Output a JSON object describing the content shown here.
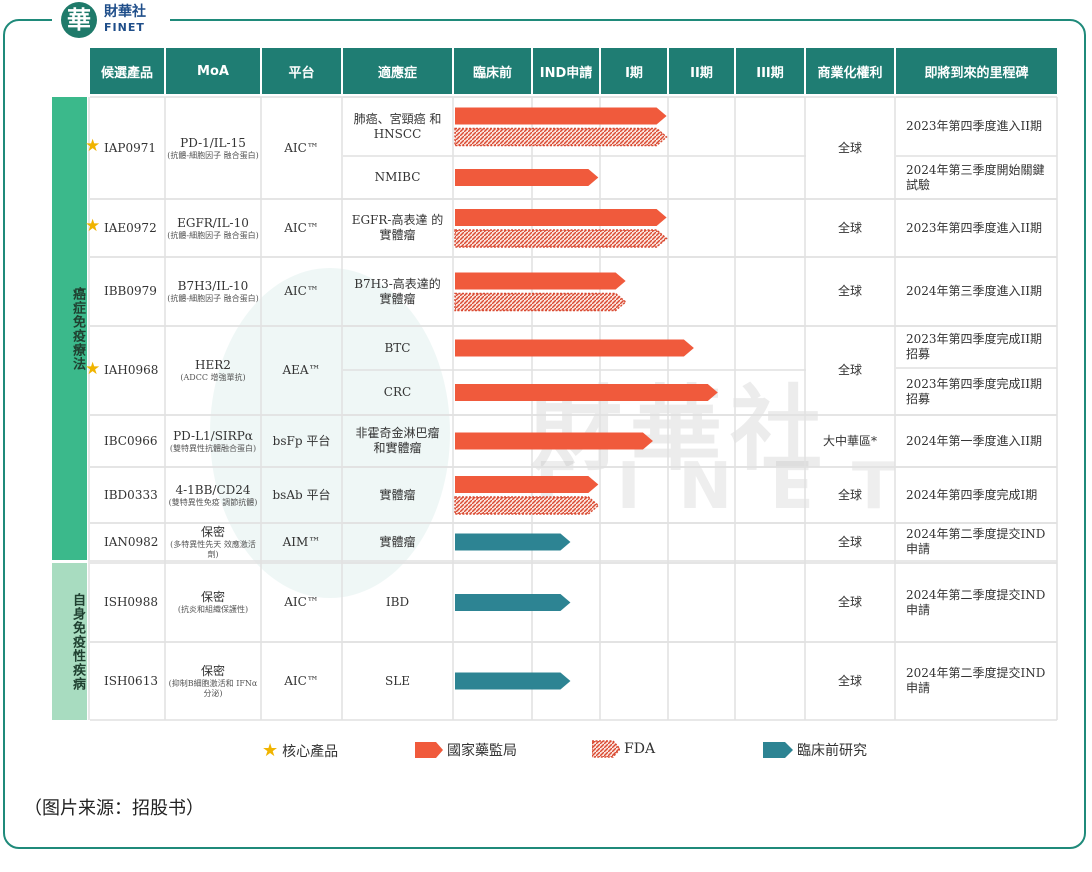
{
  "brand": {
    "mark": "華",
    "name": "財華社",
    "sub": "FINET"
  },
  "watermark": {
    "text": "財華社",
    "sub": "FINET"
  },
  "headers": [
    "候選產品",
    "MoA",
    "平台",
    "適應症",
    "臨床前",
    "IND申請",
    "I期",
    "II期",
    "III期",
    "商業化權利",
    "即將到來的里程碑"
  ],
  "categories": [
    {
      "label": "癌症免疫療法",
      "color": "#3bb98b"
    },
    {
      "label": "自身免疫性疾病",
      "color": "#a8dcc0"
    }
  ],
  "rows": [
    {
      "product": "IAP0971",
      "core": true,
      "moa": "PD-1/IL-15",
      "moa_sub": "(抗體-細胞因子 融合蛋白)",
      "platform": "AIC™",
      "indications": [
        {
          "name": "肺癌、宮頸癌 和HNSCC",
          "nmpa": 0.88,
          "fda": 0.88
        },
        {
          "name": "NMIBC",
          "nmpa": 0.6
        }
      ],
      "rights": "全球",
      "milestones": [
        "2023年第四季度進入II期",
        "2024年第三季度開始關鍵 試驗"
      ]
    },
    {
      "product": "IAE0972",
      "core": true,
      "moa": "EGFR/IL-10",
      "moa_sub": "(抗體-細胞因子 融合蛋白)",
      "platform": "AIC™",
      "indications": [
        {
          "name": "EGFR-高表達 的實體瘤",
          "nmpa": 0.88,
          "fda": 0.88
        }
      ],
      "rights": "全球",
      "milestones": [
        "2023年第四季度進入II期"
      ]
    },
    {
      "product": "IBB0979",
      "core": false,
      "moa": "B7H3/IL-10",
      "moa_sub": "(抗體-細胞因子 融合蛋白)",
      "platform": "AIC™",
      "indications": [
        {
          "name": "B7H3-高表達的 實體瘤",
          "nmpa": 0.72,
          "fda": 0.72
        }
      ],
      "rights": "全球",
      "milestones": [
        "2024年第三季度進入II期"
      ]
    },
    {
      "product": "IAH0968",
      "core": true,
      "moa": "HER2",
      "moa_sub": "(ADCC 增強單抗)",
      "platform": "AEA™",
      "indications": [
        {
          "name": "BTC",
          "nmpa": 1.0
        },
        {
          "name": "CRC",
          "nmpa": 1.1
        }
      ],
      "rights": "全球",
      "milestones": [
        "2023年第四季度完成II期 招募",
        "2023年第四季度完成II期 招募"
      ]
    },
    {
      "product": "IBC0966",
      "core": false,
      "moa": "PD-L1/SIRPα",
      "moa_sub": "(雙特異性抗體融合蛋白)",
      "platform": "bsFp 平台",
      "indications": [
        {
          "name": "非霍奇金淋巴瘤 和實體瘤",
          "nmpa": 0.8
        }
      ],
      "rights": "大中華區*",
      "milestones": [
        "2024年第一季度進入II期"
      ]
    },
    {
      "product": "IBD0333",
      "core": false,
      "moa": "4-1BB/CD24",
      "moa_sub": "(雙特異性免疫 調節抗體)",
      "platform": "bsAb 平台",
      "indications": [
        {
          "name": "實體瘤",
          "nmpa": 0.6,
          "fda": 0.6
        }
      ],
      "rights": "全球",
      "milestones": [
        "2024年第四季度完成I期"
      ]
    },
    {
      "product": "IAN0982",
      "core": false,
      "moa": "保密",
      "moa_sub": "(多特異性先天 效應激活劑)",
      "platform": "AIM™",
      "indications": [
        {
          "name": "實體瘤",
          "pre": 0.53
        }
      ],
      "rights": "全球",
      "milestones": [
        "2024年第二季度提交IND 申請"
      ]
    },
    {
      "product": "ISH0988",
      "core": false,
      "moa": "保密",
      "moa_sub": "(抗炎和組織保護性)",
      "platform": "AIC™",
      "indications": [
        {
          "name": "IBD",
          "pre": 0.53
        }
      ],
      "rights": "全球",
      "milestones": [
        "2024年第二季度提交IND 申請"
      ]
    },
    {
      "product": "ISH0613",
      "core": false,
      "moa": "保密",
      "moa_sub": "(抑制B細胞激活和 IFNα分泌)",
      "platform": "AIC™",
      "indications": [
        {
          "name": "SLE",
          "pre": 0.53
        }
      ],
      "rights": "全球",
      "milestones": [
        "2024年第二季度提交IND 申請"
      ]
    }
  ],
  "legend": [
    {
      "label": "核心產品",
      "icon": "star"
    },
    {
      "label": "國家藥監局",
      "icon": "nmpa-arrow"
    },
    {
      "label": "FDA",
      "icon": "fda-arrow"
    },
    {
      "label": "臨床前研究",
      "icon": "preclinical-arrow"
    }
  ],
  "source": "（图片来源：招股书）",
  "colors": {
    "header": "#1f7d73",
    "nmpa": "#f05a3c",
    "fda": "#d94a32",
    "preclinical": "#2d8493",
    "star": "#f0b400"
  },
  "chart_data": {
    "type": "table",
    "stages": [
      "臨床前",
      "IND申請",
      "I期",
      "II期",
      "III期"
    ],
    "note": "Progress values are measured in stage units from start of 臨床前 (1 unit = one stage column).",
    "rows": [
      {
        "product": "IAP0971",
        "indication": "肺癌、宮頸癌 和HNSCC",
        "nmpa": 3.1,
        "fda": 3.1
      },
      {
        "product": "IAP0971",
        "indication": "NMIBC",
        "nmpa": 2.1
      },
      {
        "product": "IAE0972",
        "indication": "EGFR-高表達 的實體瘤",
        "nmpa": 3.1,
        "fda": 3.1
      },
      {
        "product": "IBB0979",
        "indication": "B7H3-高表達的 實體瘤",
        "nmpa": 2.5,
        "fda": 2.5
      },
      {
        "product": "IAH0968",
        "indication": "BTC",
        "nmpa": 3.5
      },
      {
        "product": "IAH0968",
        "indication": "CRC",
        "nmpa": 3.85
      },
      {
        "product": "IBC0966",
        "indication": "非霍奇金淋巴瘤 和實體瘤",
        "nmpa": 2.9
      },
      {
        "product": "IBD0333",
        "indication": "實體瘤",
        "nmpa": 2.1,
        "fda": 2.1
      },
      {
        "product": "IAN0982",
        "indication": "實體瘤",
        "preclinical": 1.85
      },
      {
        "product": "ISH0988",
        "indication": "IBD",
        "preclinical": 1.85
      },
      {
        "product": "ISH0613",
        "indication": "SLE",
        "preclinical": 1.85
      }
    ]
  }
}
